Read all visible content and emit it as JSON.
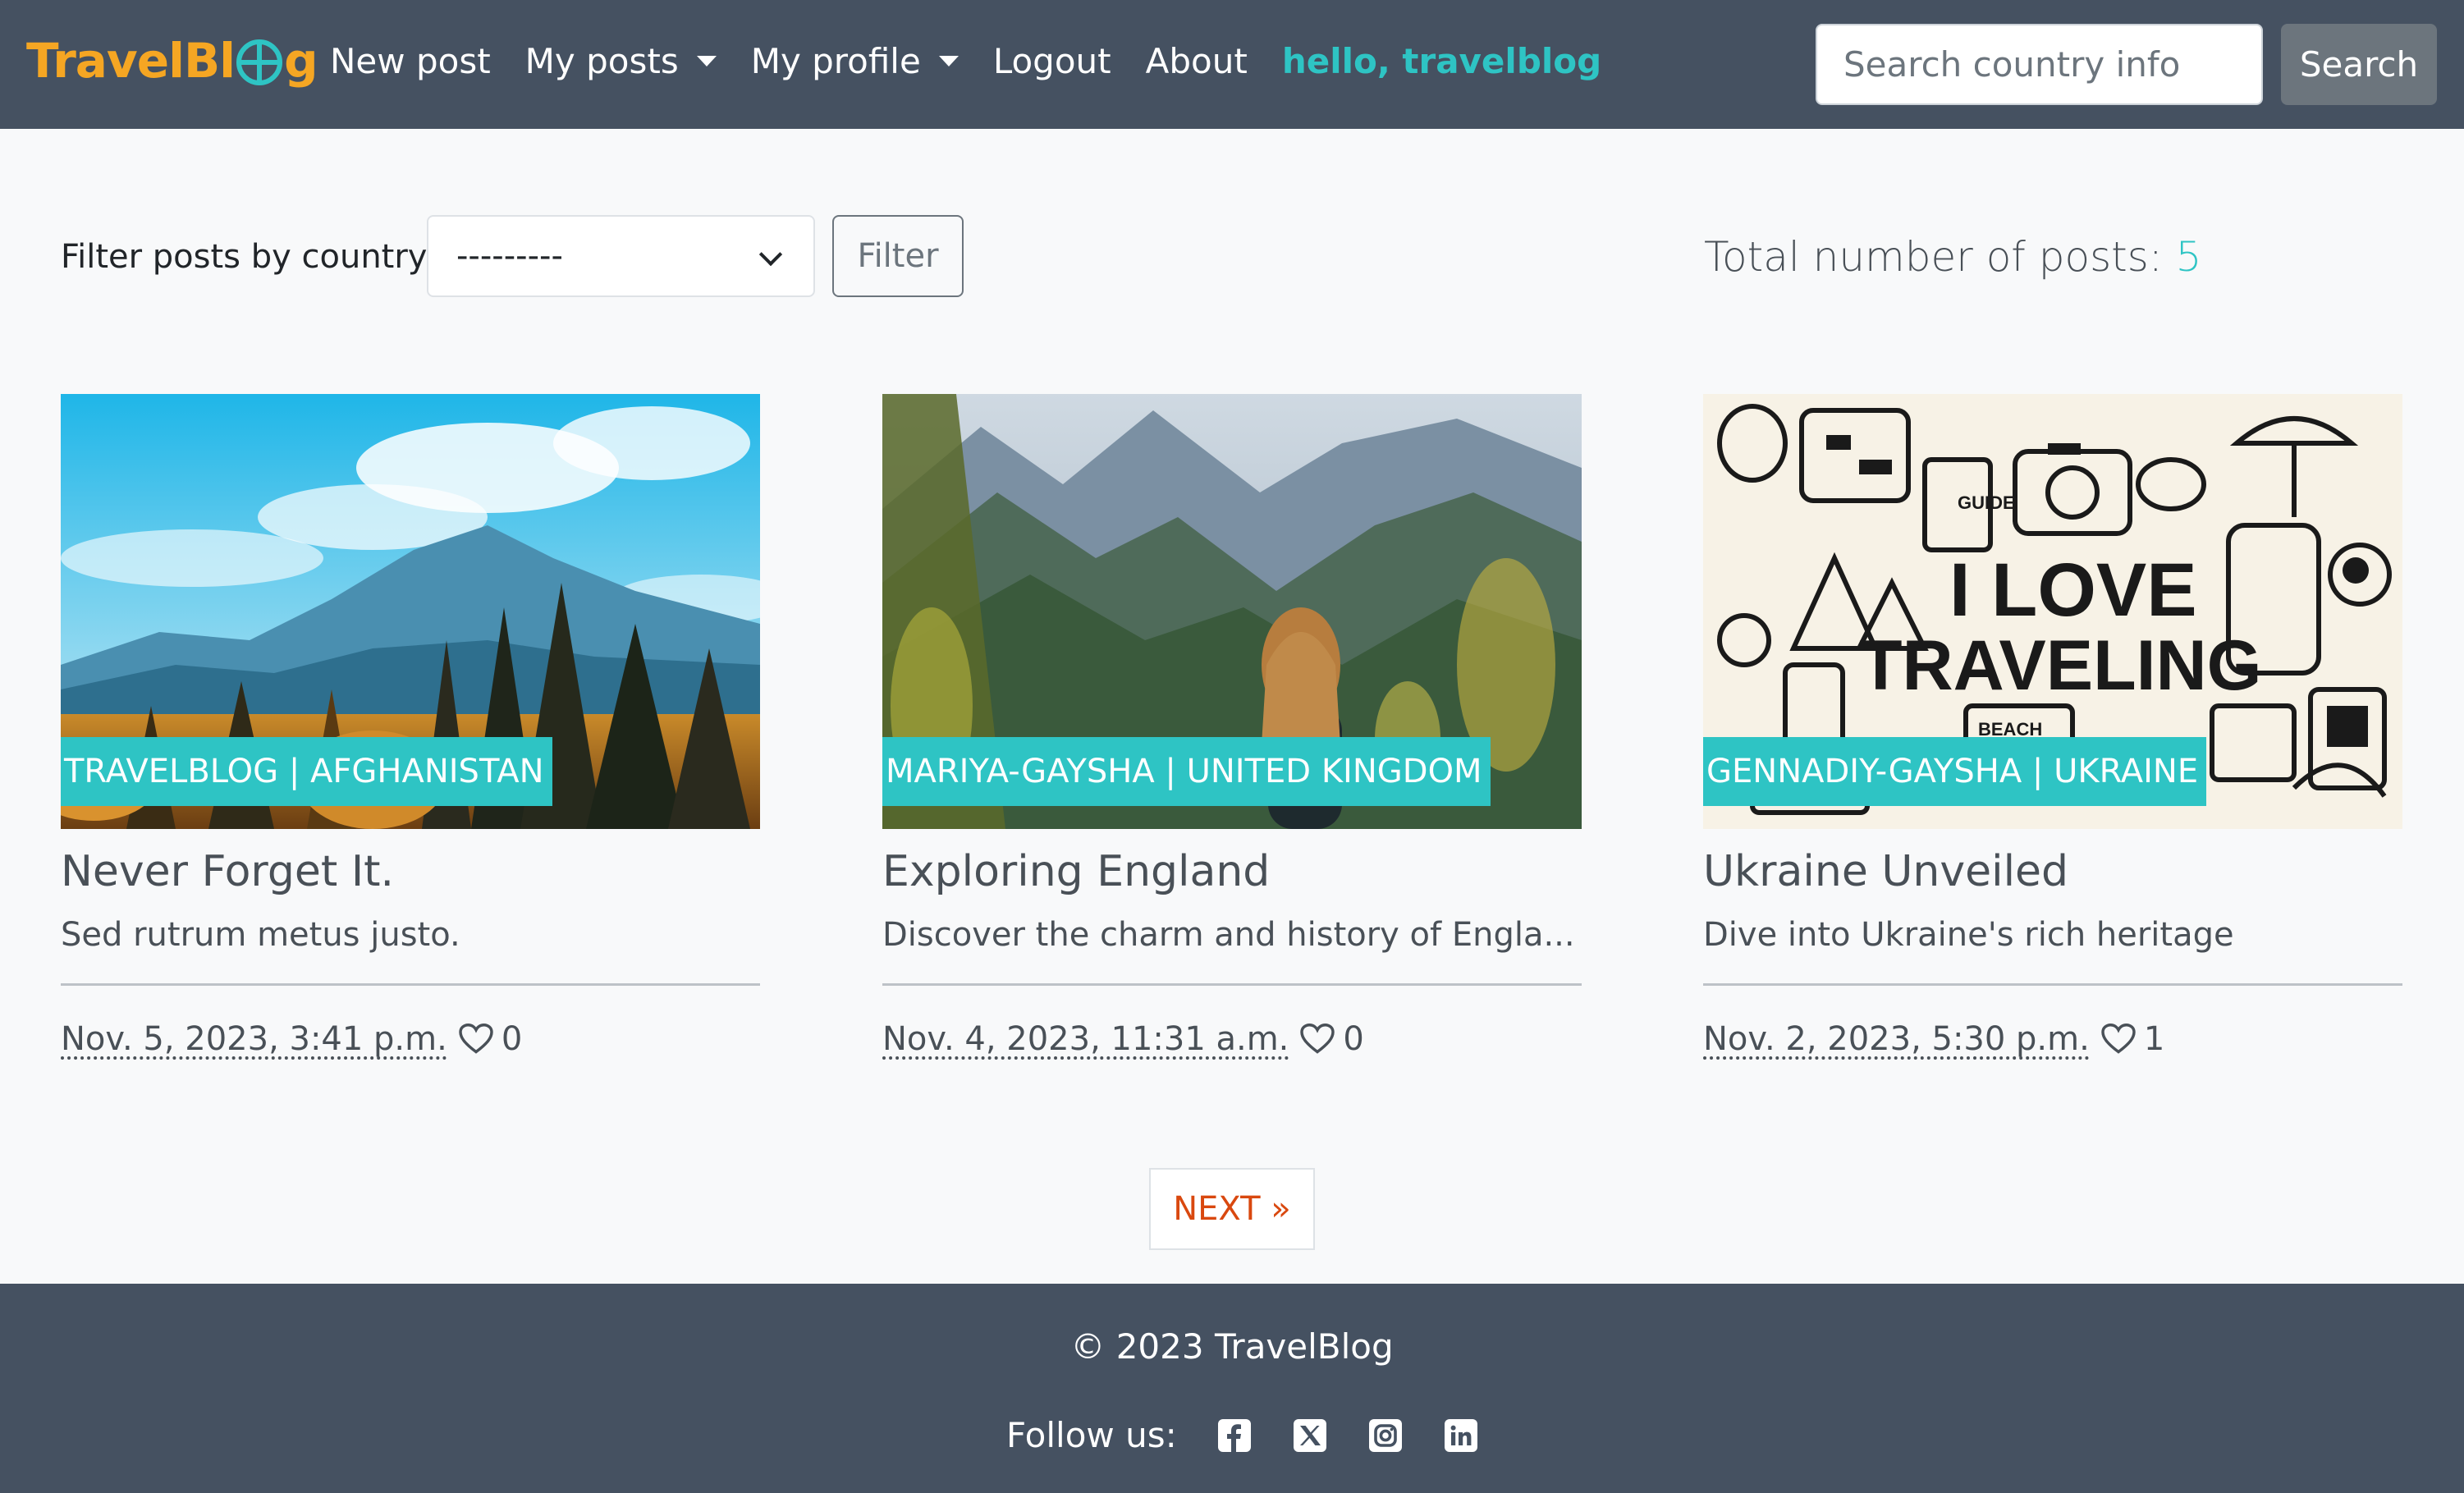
{
  "navbar": {
    "brand_prefix": "TravelBl",
    "brand_suffix": "g",
    "links": {
      "new_post": "New post",
      "my_posts": "My posts",
      "my_profile": "My profile",
      "logout": "Logout",
      "about": "About"
    },
    "greeting": "hello, travelblog",
    "search_placeholder": "Search country info",
    "search_button": "Search"
  },
  "filter": {
    "label": "Filter posts by country:",
    "selected": "---------",
    "button": "Filter"
  },
  "total": {
    "label": "Total number of posts:",
    "count": "5"
  },
  "posts": [
    {
      "badge": "TRAVELBLOG | AFGHANISTAN",
      "title": "Never Forget It.",
      "excerpt": "Sed rutrum metus justo.",
      "date": "Nov. 5, 2023, 3:41 p.m.",
      "likes": "0"
    },
    {
      "badge": "MARIYA-GAYSHA | UNITED KINGDOM",
      "title": "Exploring England",
      "excerpt": "Discover the charm and history of Engla...",
      "date": "Nov. 4, 2023, 11:31 a.m.",
      "likes": "0"
    },
    {
      "badge": "GENNADIY-GAYSHA | UKRAINE",
      "title": "Ukraine Unveiled",
      "excerpt": "Dive into Ukraine's rich heritage",
      "date": "Nov. 2, 2023, 5:30 p.m.",
      "likes": "1"
    }
  ],
  "image_texts": {
    "love": "I LOVE",
    "traveling": "TRAVELING",
    "guide": "GUIDE",
    "beach": "BEACH"
  },
  "pagination": {
    "next": "NEXT »"
  },
  "footer": {
    "copyright": "© 2023 TravelBlog",
    "follow": "Follow us:",
    "icons": [
      "facebook-icon",
      "x-icon",
      "instagram-icon",
      "linkedin-icon"
    ]
  },
  "colors": {
    "navbar_bg": "#455161",
    "accent_teal": "#2ec4c4",
    "brand_orange": "#f5a623",
    "next_orange": "#d9480f"
  }
}
